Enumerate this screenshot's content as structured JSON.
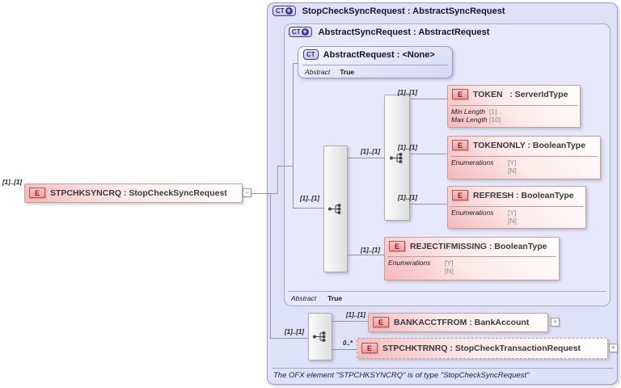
{
  "icons": {
    "element_badge": "E",
    "complex_type_badge": "CT",
    "plus_glyph": "+",
    "collapse_toggle": "−",
    "expand_toggle": "+"
  },
  "root_element": {
    "occurrence": "[1]..[1]",
    "label": "STPCHKSYNCRQ : StopCheckSyncRequest"
  },
  "outer_container": {
    "title": "StopCheckSyncRequest : AbstractSyncRequest",
    "footer_note": "The OFX element \"STPCHKSYNCRQ\" is of type \"StopCheckSyncRequest\""
  },
  "inner_container": {
    "title": "AbstractSyncRequest : AbstractRequest",
    "abstract_name": "Abstract",
    "abstract_value": "True",
    "sequence_occurrence": "[1]..[1]",
    "inner_sequence_occurrence": "[1]..[1]"
  },
  "base_type": {
    "title": "AbstractRequest : <None>",
    "abstract_name": "Abstract",
    "abstract_value": "True"
  },
  "own_sequence_occurrence": "[1]..[1]",
  "elements": {
    "token": {
      "occurrence": "[1]..[1]",
      "title": "TOKEN   : ServerIdType",
      "facets": [
        {
          "name": "Min Length",
          "value": "[1]"
        },
        {
          "name": "Max Length",
          "value": "[10]"
        }
      ]
    },
    "tokenonly": {
      "occurrence": "[1]..[1]",
      "title": "TOKENONLY : BooleanType",
      "facets": [
        {
          "name": "Enumerations",
          "value": "[Y]"
        },
        {
          "name": "",
          "value": "[N]"
        }
      ]
    },
    "refresh": {
      "occurrence": "[1]..[1]",
      "title": "REFRESH : BooleanType",
      "facets": [
        {
          "name": "Enumerations",
          "value": "[Y]"
        },
        {
          "name": "",
          "value": "[N]"
        }
      ]
    },
    "rejectifmissing": {
      "occurrence": "[1]..[1]",
      "title": "REJECTIFMISSING : BooleanType",
      "facets": [
        {
          "name": "Enumerations",
          "value": "[Y]"
        },
        {
          "name": "",
          "value": "[N]"
        }
      ]
    },
    "bankacctfrom": {
      "occurrence": "[1]..[1]",
      "title": "BANKACCTFROM : BankAccount"
    },
    "stpchktrnrq": {
      "occurrence": "0..*",
      "title": "STPCHKTRNRQ : StopCheckTransactionRequest"
    }
  }
}
